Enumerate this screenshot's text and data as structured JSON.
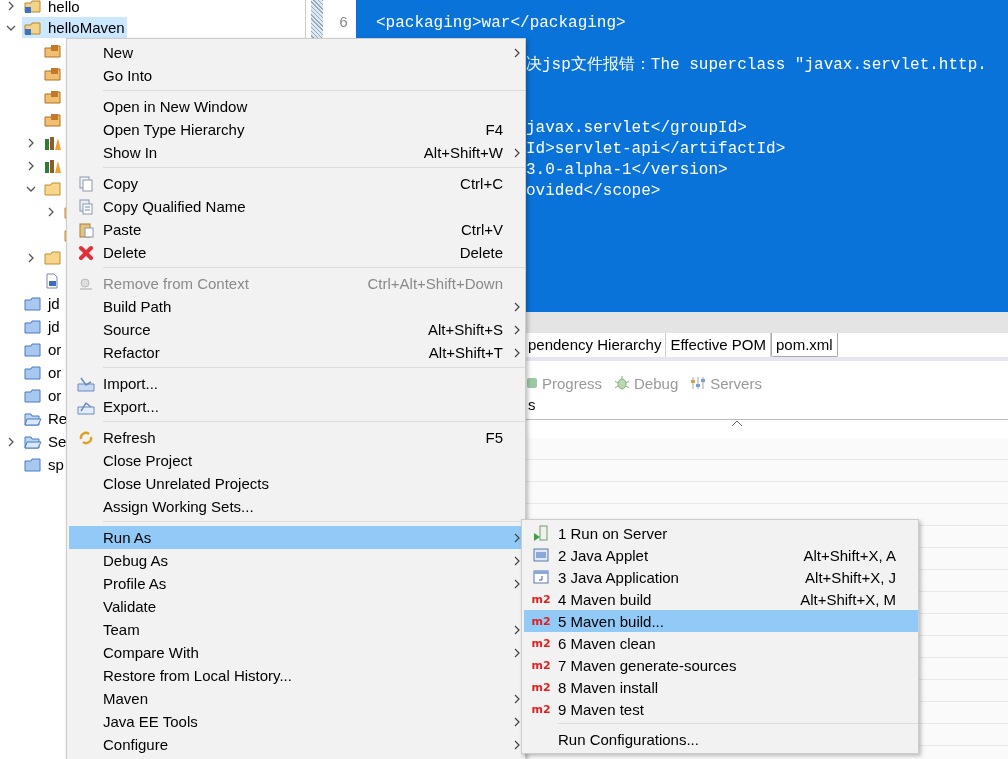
{
  "project_explorer": {
    "items": [
      {
        "label": "hello",
        "kind": "project",
        "expanded": false,
        "selected": false
      },
      {
        "label": "helloMaven",
        "kind": "project",
        "expanded": true,
        "selected": true,
        "children": [
          {
            "kind": "package",
            "selected": false
          },
          {
            "kind": "package",
            "selected": false
          },
          {
            "kind": "package",
            "selected": false
          },
          {
            "kind": "package",
            "selected": false
          },
          {
            "kind": "library",
            "expanded": false,
            "selected": false
          },
          {
            "kind": "library",
            "expanded": false,
            "selected": false
          },
          {
            "kind": "folder",
            "expanded": true,
            "selected": false,
            "children": [
              {
                "kind": "folder",
                "expanded": false,
                "selected": false
              },
              {
                "kind": "folder",
                "selected": false
              }
            ]
          },
          {
            "kind": "folder",
            "expanded": false,
            "selected": false
          },
          {
            "kind": "pom",
            "selected": false
          }
        ]
      },
      {
        "label": "jd",
        "kind": "closed-project",
        "selected": false
      },
      {
        "label": "jd",
        "kind": "closed-project",
        "selected": false
      },
      {
        "label": "or",
        "kind": "closed-project",
        "selected": false
      },
      {
        "label": "or",
        "kind": "closed-project",
        "selected": false
      },
      {
        "label": "or",
        "kind": "closed-project",
        "selected": false
      },
      {
        "label": "Re",
        "kind": "open-project",
        "selected": false
      },
      {
        "label": "Se",
        "kind": "open-project",
        "expanded": false,
        "selected": false
      },
      {
        "label": "sp",
        "kind": "closed-project",
        "selected": false
      }
    ]
  },
  "editor": {
    "lines": [
      {
        "kind": "full",
        "number": "6",
        "text": "<packaging>war</packaging>"
      },
      {
        "kind": "blank"
      },
      {
        "kind": "tail",
        "text": "决jsp文件报错：The superclass \"javax.servlet.http."
      },
      {
        "kind": "blank"
      },
      {
        "kind": "blank"
      },
      {
        "kind": "tail",
        "text": "javax.servlet</groupId>"
      },
      {
        "kind": "tail",
        "text": "Id>servlet-api</artifactId>"
      },
      {
        "kind": "tail",
        "text": "3.0-alpha-1</version>"
      },
      {
        "kind": "tail",
        "text": "ovided</scope>"
      }
    ]
  },
  "bottom_panel": {
    "editor_tabs": [
      {
        "label": "pendency Hierarchy",
        "selected": false
      },
      {
        "label": "Effective POM",
        "selected": false
      },
      {
        "label": "pom.xml",
        "selected": true
      }
    ],
    "views": [
      {
        "label": "Progress"
      },
      {
        "label": "Debug"
      },
      {
        "label": "Servers"
      }
    ],
    "section_label": "s"
  },
  "context_menu": {
    "items": [
      {
        "kind": "item",
        "label": "New",
        "submenu": true,
        "disabled": false,
        "selected": false
      },
      {
        "kind": "item",
        "label": "Go Into",
        "submenu": false,
        "disabled": false,
        "selected": false
      },
      {
        "kind": "separator"
      },
      {
        "kind": "item",
        "label": "Open in New Window",
        "submenu": false,
        "disabled": false,
        "selected": false
      },
      {
        "kind": "item",
        "label": "Open Type Hierarchy",
        "shortcut": "F4",
        "submenu": false,
        "disabled": false,
        "selected": false
      },
      {
        "kind": "item",
        "label": "Show In",
        "shortcut": "Alt+Shift+W",
        "submenu": true,
        "disabled": false,
        "selected": false
      },
      {
        "kind": "separator"
      },
      {
        "kind": "item",
        "label": "Copy",
        "shortcut": "Ctrl+C",
        "submenu": false,
        "disabled": false,
        "selected": false
      },
      {
        "kind": "item",
        "label": "Copy Qualified Name",
        "submenu": false,
        "disabled": false,
        "selected": false
      },
      {
        "kind": "item",
        "label": "Paste",
        "shortcut": "Ctrl+V",
        "submenu": false,
        "disabled": false,
        "selected": false
      },
      {
        "kind": "item",
        "label": "Delete",
        "shortcut": "Delete",
        "submenu": false,
        "disabled": false,
        "selected": false
      },
      {
        "kind": "separator"
      },
      {
        "kind": "item",
        "label": "Remove from Context",
        "shortcut": "Ctrl+Alt+Shift+Down",
        "submenu": false,
        "disabled": true,
        "selected": false
      },
      {
        "kind": "item",
        "label": "Build Path",
        "submenu": true,
        "disabled": false,
        "selected": false
      },
      {
        "kind": "item",
        "label": "Source",
        "shortcut": "Alt+Shift+S",
        "submenu": true,
        "disabled": false,
        "selected": false
      },
      {
        "kind": "item",
        "label": "Refactor",
        "shortcut": "Alt+Shift+T",
        "submenu": true,
        "disabled": false,
        "selected": false
      },
      {
        "kind": "separator"
      },
      {
        "kind": "item",
        "label": "Import...",
        "submenu": false,
        "disabled": false,
        "selected": false
      },
      {
        "kind": "item",
        "label": "Export...",
        "submenu": false,
        "disabled": false,
        "selected": false
      },
      {
        "kind": "separator"
      },
      {
        "kind": "item",
        "label": "Refresh",
        "shortcut": "F5",
        "submenu": false,
        "disabled": false,
        "selected": false
      },
      {
        "kind": "item",
        "label": "Close Project",
        "submenu": false,
        "disabled": false,
        "selected": false
      },
      {
        "kind": "item",
        "label": "Close Unrelated Projects",
        "submenu": false,
        "disabled": false,
        "selected": false
      },
      {
        "kind": "item",
        "label": "Assign Working Sets...",
        "submenu": false,
        "disabled": false,
        "selected": false
      },
      {
        "kind": "separator"
      },
      {
        "kind": "item",
        "label": "Run As",
        "submenu": true,
        "disabled": false,
        "selected": true
      },
      {
        "kind": "item",
        "label": "Debug As",
        "submenu": true,
        "disabled": false,
        "selected": false
      },
      {
        "kind": "item",
        "label": "Profile As",
        "submenu": true,
        "disabled": false,
        "selected": false
      },
      {
        "kind": "item",
        "label": "Validate",
        "submenu": false,
        "disabled": false,
        "selected": false
      },
      {
        "kind": "item",
        "label": "Team",
        "submenu": true,
        "disabled": false,
        "selected": false
      },
      {
        "kind": "item",
        "label": "Compare With",
        "submenu": true,
        "disabled": false,
        "selected": false
      },
      {
        "kind": "item",
        "label": "Restore from Local History...",
        "submenu": false,
        "disabled": false,
        "selected": false
      },
      {
        "kind": "item",
        "label": "Maven",
        "submenu": true,
        "disabled": false,
        "selected": false
      },
      {
        "kind": "item",
        "label": "Java EE Tools",
        "submenu": true,
        "disabled": false,
        "selected": false
      },
      {
        "kind": "item",
        "label": "Configure",
        "submenu": true,
        "disabled": false,
        "selected": false
      }
    ]
  },
  "submenu": {
    "items": [
      {
        "kind": "item",
        "label": "1 Run on Server",
        "submenu": false,
        "disabled": false,
        "selected": false
      },
      {
        "kind": "item",
        "label": "2 Java Applet",
        "shortcut": "Alt+Shift+X, A",
        "submenu": false,
        "disabled": false,
        "selected": false
      },
      {
        "kind": "item",
        "label": "3 Java Application",
        "shortcut": "Alt+Shift+X, J",
        "submenu": false,
        "disabled": false,
        "selected": false
      },
      {
        "kind": "item",
        "icon_text": "m2",
        "label": "4 Maven build",
        "shortcut": "Alt+Shift+X, M",
        "submenu": false,
        "disabled": false,
        "selected": false
      },
      {
        "kind": "item",
        "icon_text": "m2",
        "label": "5 Maven build...",
        "submenu": false,
        "disabled": false,
        "selected": true
      },
      {
        "kind": "item",
        "icon_text": "m2",
        "label": "6 Maven clean",
        "submenu": false,
        "disabled": false,
        "selected": false
      },
      {
        "kind": "item",
        "icon_text": "m2",
        "label": "7 Maven generate-sources",
        "submenu": false,
        "disabled": false,
        "selected": false
      },
      {
        "kind": "item",
        "icon_text": "m2",
        "label": "8 Maven install",
        "submenu": false,
        "disabled": false,
        "selected": false
      },
      {
        "kind": "item",
        "icon_text": "m2",
        "label": "9 Maven test",
        "submenu": false,
        "disabled": false,
        "selected": false
      },
      {
        "kind": "separator"
      },
      {
        "kind": "item",
        "label": "Run Configurations...",
        "submenu": false,
        "disabled": false,
        "selected": false
      }
    ]
  }
}
